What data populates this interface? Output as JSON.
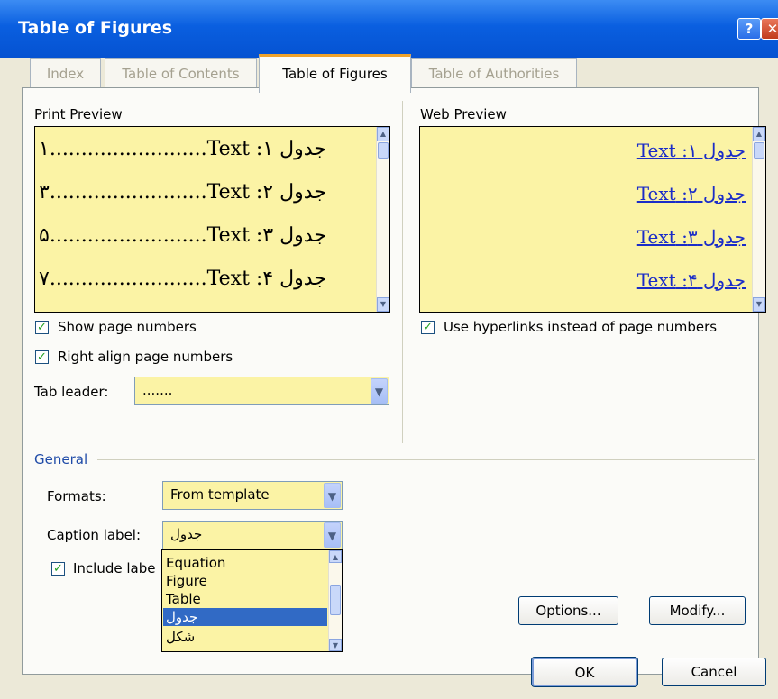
{
  "window": {
    "title": "Table of Figures",
    "help_glyph": "?",
    "close_glyph": "✕"
  },
  "tabs": [
    {
      "label": "Index",
      "active": false
    },
    {
      "label": "Table of Contents",
      "active": false
    },
    {
      "label": "Table of Figures",
      "active": true
    },
    {
      "label": "Table of Authorities",
      "active": false
    }
  ],
  "print_preview": {
    "label": "Print Preview",
    "entries": [
      {
        "caption": "جدول ۱: Text",
        "page": "۱"
      },
      {
        "caption": "جدول ۲: Text",
        "page": "۳"
      },
      {
        "caption": "جدول ۳: Text",
        "page": "۵"
      },
      {
        "caption": "جدول ۴: Text",
        "page": "۷"
      }
    ]
  },
  "web_preview": {
    "label": "Web Preview",
    "entries": [
      "جدول ۱: Text",
      "جدول ۲: Text",
      "جدول ۳: Text",
      "جدول ۴: Text"
    ]
  },
  "options": {
    "show_page_numbers": {
      "label": "Show page numbers",
      "checked": true
    },
    "right_align": {
      "label": "Right align page numbers",
      "checked": true
    },
    "tab_leader": {
      "label": "Tab leader:",
      "value": "......."
    },
    "use_hyperlinks": {
      "label": "Use hyperlinks instead of page numbers",
      "checked": true
    }
  },
  "general": {
    "heading": "General",
    "formats": {
      "label": "Formats:",
      "value": "From template"
    },
    "caption_label": {
      "label": "Caption label:",
      "value": "جدول"
    },
    "include_label": {
      "label": "Include labe",
      "checked": true
    },
    "caption_options": [
      "Equation",
      "Figure",
      "Table",
      "جدول",
      "شکل"
    ],
    "selected_option": "جدول"
  },
  "buttons": {
    "options": "Options...",
    "modify": "Modify...",
    "ok": "OK",
    "cancel": "Cancel"
  },
  "colors": {
    "title_bar": "#0552d1",
    "preview_bg": "#fbf3a5",
    "selection": "#316ac5",
    "active_tab_accent": "#f0a22a",
    "link": "#1a2cc8"
  }
}
